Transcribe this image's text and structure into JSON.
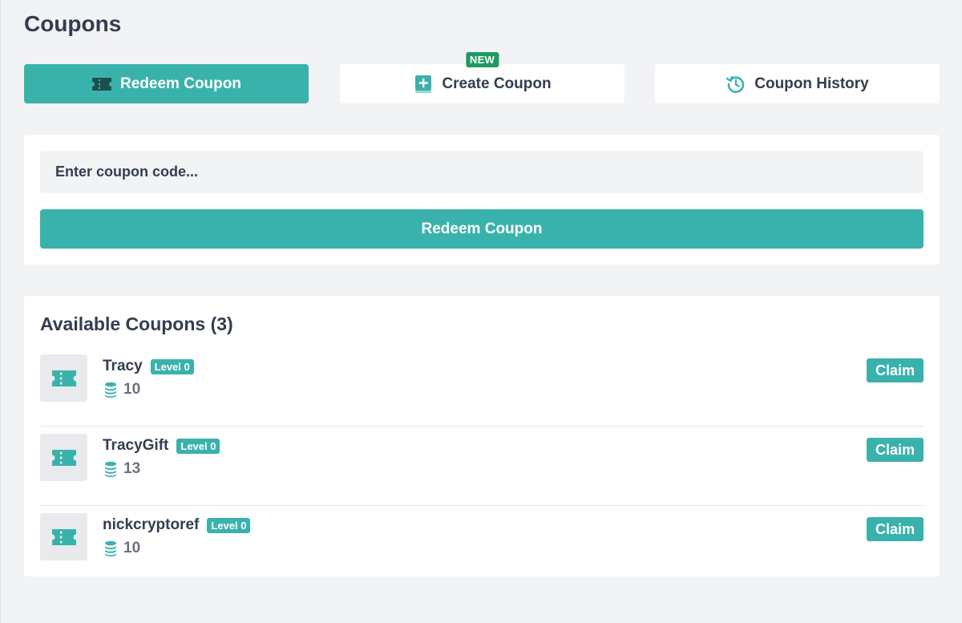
{
  "page": {
    "title": "Coupons"
  },
  "tabs": [
    {
      "label": "Redeem Coupon",
      "icon": "ticket-icon",
      "active": true
    },
    {
      "label": "Create Coupon",
      "icon": "add-book-icon",
      "badge": "NEW"
    },
    {
      "label": "Coupon History",
      "icon": "history-icon"
    }
  ],
  "redeem": {
    "placeholder": "Enter coupon code...",
    "button_label": "Redeem Coupon"
  },
  "available": {
    "title": "Available Coupons (3)",
    "claim_label": "Claim",
    "items": [
      {
        "name": "Tracy",
        "level": "Level 0",
        "amount": "10"
      },
      {
        "name": "TracyGift",
        "level": "Level 0",
        "amount": "13"
      },
      {
        "name": "nickcryptoref",
        "level": "Level 0",
        "amount": "10"
      }
    ]
  },
  "colors": {
    "accent": "#3ab2ac",
    "new_badge": "#1e9a62",
    "background": "#f2f3f5",
    "text": "#343d4f"
  }
}
